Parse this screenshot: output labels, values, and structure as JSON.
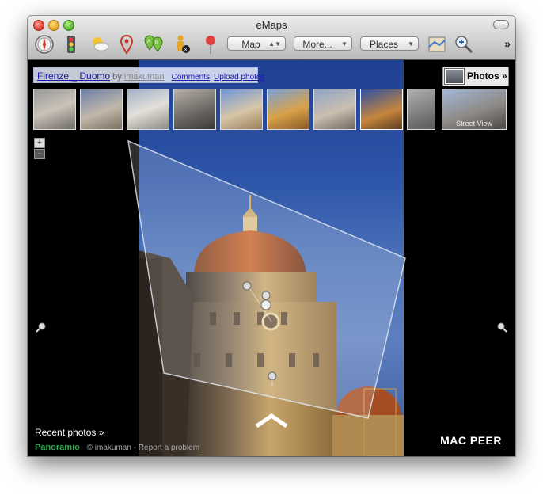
{
  "window": {
    "title": "eMaps"
  },
  "toolbar": {
    "icons": [
      "compass-icon",
      "traffic-light-icon",
      "weather-icon",
      "pin-icon",
      "ab-pins-icon",
      "person-icon",
      "push-pin-icon"
    ],
    "map_select": "Map",
    "more_select": "More...",
    "places_select": "Places",
    "overflow_label": "»"
  },
  "photo_header": {
    "title": "Firenze _ Duomo",
    "by": "by",
    "author": "imakuman",
    "comments_label": "Comments",
    "upload_label": "Upload photos"
  },
  "photos_button": {
    "label": "Photos »"
  },
  "thumbnails": {
    "street_view_label": "Street View"
  },
  "zoom": {
    "plus": "+",
    "minus": "−"
  },
  "bottom": {
    "recent_label": "Recent photos »",
    "logo_text": "Panoramio",
    "copyright": "© imakuman - ",
    "report_link": "Report a problem",
    "watermark": "MAC PEER"
  },
  "colors": {
    "sky": "#2d55a8",
    "link": "#1a1aa6",
    "logo": "#2fa84f"
  }
}
